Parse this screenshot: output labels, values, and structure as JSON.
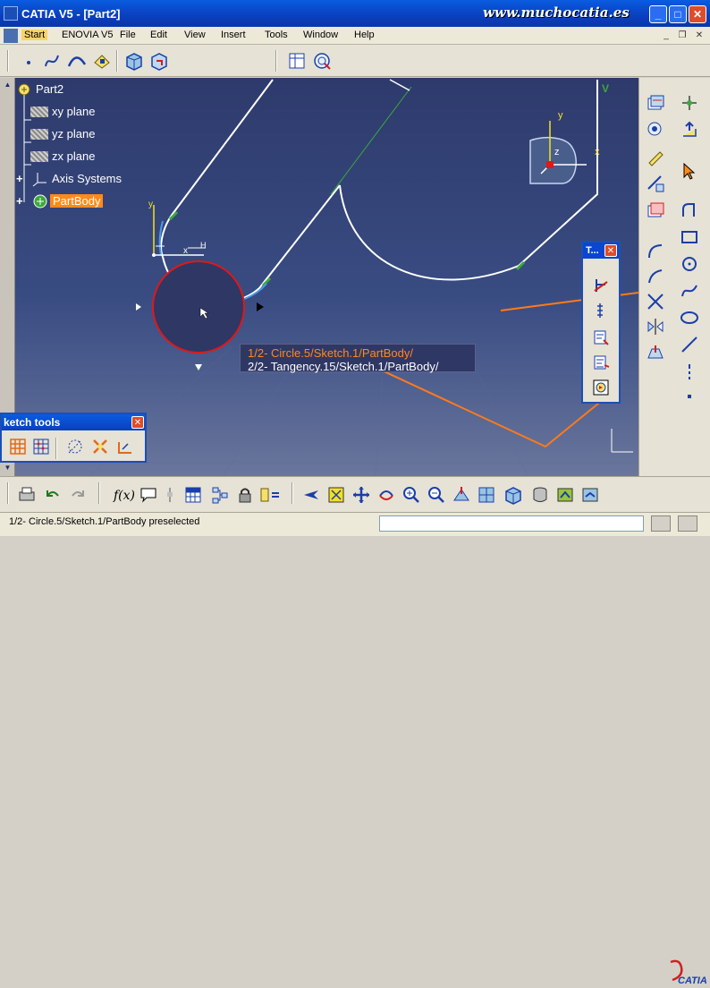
{
  "window": {
    "title": "CATIA V5 - [Part2]",
    "watermark": "www.muchocatia.es",
    "minimize": "_",
    "maximize": "□",
    "close": "✕"
  },
  "menu": {
    "items": [
      "Start",
      "ENOVIA V5",
      "File",
      "Edit",
      "View",
      "Insert",
      "Tools",
      "Window",
      "Help"
    ],
    "mdi_minimize": "_",
    "mdi_restore": "❐",
    "mdi_close": "✕"
  },
  "tree": {
    "root": "Part2",
    "items": [
      {
        "label": "xy plane",
        "icon": "plane-icon"
      },
      {
        "label": "yz plane",
        "icon": "plane-icon"
      },
      {
        "label": "zx plane",
        "icon": "plane-icon"
      },
      {
        "label": "Axis Systems",
        "icon": "axis-system-icon"
      },
      {
        "label": "PartBody",
        "icon": "partbody-icon"
      }
    ]
  },
  "viewport": {
    "axis_y": "y",
    "axis_z": "z",
    "axis_x": "x",
    "sketch_v": "V",
    "sketch_h": "H"
  },
  "tooltip": {
    "line1": "1/2-  Circle.5/Sketch.1/PartBody/",
    "line2": "2/2-  Tangency.15/Sketch.1/PartBody/"
  },
  "float_toolbar": {
    "title": "T...",
    "close": "✕"
  },
  "sketch_tools": {
    "title": "ketch tools",
    "close": "✕"
  },
  "status": {
    "text": "1/2-  Circle.5/Sketch.1/PartBody preselected",
    "command_value": ""
  },
  "colors": {
    "viewport_top": "#2e3a6c",
    "sketch_line": "#ffffff",
    "highlight_red": "#e01818",
    "orange_line": "#ff7a1a",
    "constraint_green": "#3ca83c"
  }
}
